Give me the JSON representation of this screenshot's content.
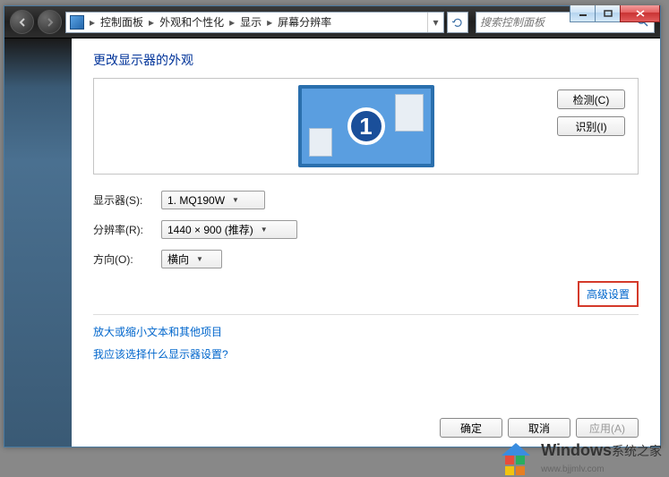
{
  "breadcrumb": {
    "items": [
      "控制面板",
      "外观和个性化",
      "显示",
      "屏幕分辨率"
    ]
  },
  "search": {
    "placeholder": "搜索控制面板"
  },
  "page": {
    "heading": "更改显示器的外观",
    "monitor_number": "1",
    "detect_btn": "检测(C)",
    "identify_btn": "识别(I)"
  },
  "fields": {
    "display_label": "显示器(S):",
    "display_value": "1. MQ190W",
    "resolution_label": "分辨率(R):",
    "resolution_value": "1440 × 900 (推荐)",
    "orientation_label": "方向(O):",
    "orientation_value": "横向"
  },
  "links": {
    "advanced": "高级设置",
    "text_size": "放大或缩小文本和其他项目",
    "which_display": "我应该选择什么显示器设置?"
  },
  "buttons": {
    "ok": "确定",
    "cancel": "取消",
    "apply": "应用(A)"
  },
  "watermark": {
    "brand": "Windows",
    "suffix": "系统之家",
    "url": "www.bjjmlv.com"
  }
}
